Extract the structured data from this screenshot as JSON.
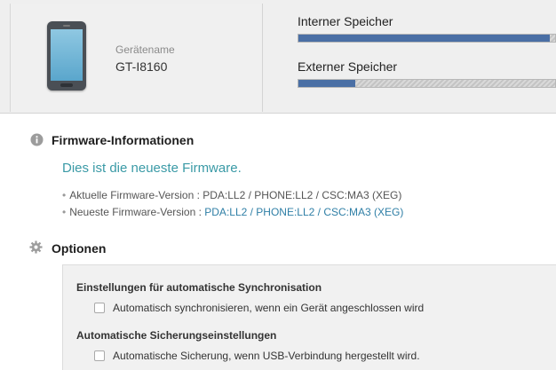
{
  "device": {
    "name_label": "Gerätename",
    "name_value": "GT-I8160",
    "icon": "phone-icon"
  },
  "storage": {
    "internal": {
      "label": "Interner Speicher",
      "used_fraction": 0.98
    },
    "external": {
      "label": "Externer Speicher",
      "used_fraction": 0.22
    }
  },
  "firmware": {
    "title": "Firmware-Informationen",
    "icon": "info-icon",
    "status": "Dies ist die neueste Firmware.",
    "current": {
      "label": "Aktuelle Firmware-Version : ",
      "value": "PDA:LL2 / PHONE:LL2 / CSC:MA3 (XEG)"
    },
    "latest": {
      "label": "Neueste Firmware-Version : ",
      "value": "PDA:LL2 / PHONE:LL2 / CSC:MA3 (XEG)"
    }
  },
  "options": {
    "title": "Optionen",
    "icon": "gear-icon",
    "sync_heading": "Einstellungen für automatische Synchronisation",
    "sync_checkbox": "Automatisch synchronisieren, wenn ein Gerät angeschlossen wird",
    "backup_heading": "Automatische Sicherungseinstellungen",
    "backup_checkbox": "Automatische Sicherung, wenn USB-Verbindung hergestellt wird."
  },
  "colors": {
    "accent_teal": "#3a9aa6",
    "link_blue": "#2f7fa6",
    "storage_fill": "#4a6fa5"
  }
}
